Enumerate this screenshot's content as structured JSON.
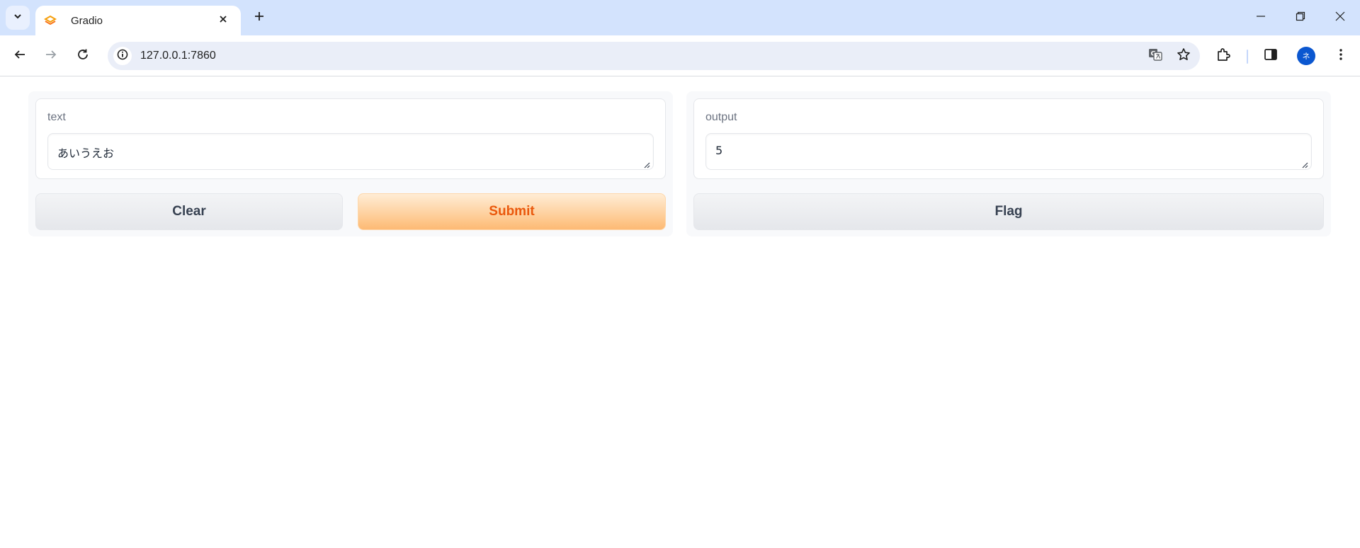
{
  "browser": {
    "tab_title": "Gradio",
    "url": "127.0.0.1:7860",
    "avatar_initial": "ネ",
    "icons": {
      "tab_search": "chevron-down-icon",
      "favicon": "gradio-logo-icon",
      "tab_close": "close-icon",
      "new_tab": "plus-icon",
      "minimize": "minimize-icon",
      "restore": "restore-icon",
      "window_close": "close-icon",
      "back": "back-arrow-icon",
      "forward": "forward-arrow-icon",
      "reload": "reload-icon",
      "site_info": "info-icon",
      "translate": "translate-icon",
      "bookmark": "star-icon",
      "extensions": "puzzle-icon",
      "side_panel": "side-panel-icon",
      "menu": "kebab-menu-icon"
    }
  },
  "app": {
    "input": {
      "label": "text",
      "value": "あいうえお"
    },
    "output": {
      "label": "output",
      "value": "5"
    },
    "buttons": {
      "clear": "Clear",
      "submit": "Submit",
      "flag": "Flag"
    },
    "colors": {
      "primary_text": "#ea580c",
      "primary_bg_top": "#ffedd5",
      "primary_bg_bottom": "#fdba74",
      "secondary_text": "#374151"
    }
  }
}
